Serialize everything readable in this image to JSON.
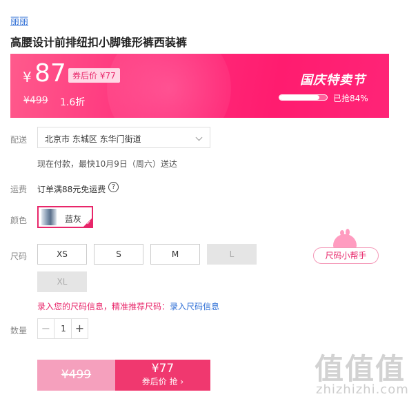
{
  "brand": "丽丽",
  "product_title": "高腰设计前排纽扣小脚锥形裤西装裤",
  "price": {
    "currency": "¥",
    "current": "87",
    "coupon_label": "券后价 ¥77",
    "original": "¥499",
    "discount": "1.6折",
    "promo_name": "国庆特卖节",
    "sold_progress": 84,
    "sold_label": "已抢84%"
  },
  "delivery": {
    "label": "配送",
    "address": "北京市 东城区 东华门街道",
    "estimate": "现在付款，最快10月9日（周六）送达"
  },
  "shipping": {
    "label": "运费",
    "text": "订单满88元免运费",
    "help_icon": "?"
  },
  "color": {
    "label": "颜色",
    "selected": "蓝灰"
  },
  "size": {
    "label": "尺码",
    "options": [
      "XS",
      "S",
      "M",
      "L",
      "XL"
    ],
    "helper": "尺码小帮手",
    "hint": "录入您的尺码信息，精准推荐尺码：",
    "hint_link": "录入尺码信息"
  },
  "quantity": {
    "label": "数量",
    "value": "1",
    "minus": "−",
    "plus": "+"
  },
  "buy": {
    "original_price": "¥499",
    "coupon_price": "¥77",
    "coupon_action": "券后价 抢 ›"
  },
  "watermark": {
    "logo": "值值值",
    "url": "zhizhizhi.com"
  },
  "colors": {
    "accent": "#e8266a",
    "banner": "#ff2d7b",
    "link": "#2f6fd6"
  }
}
